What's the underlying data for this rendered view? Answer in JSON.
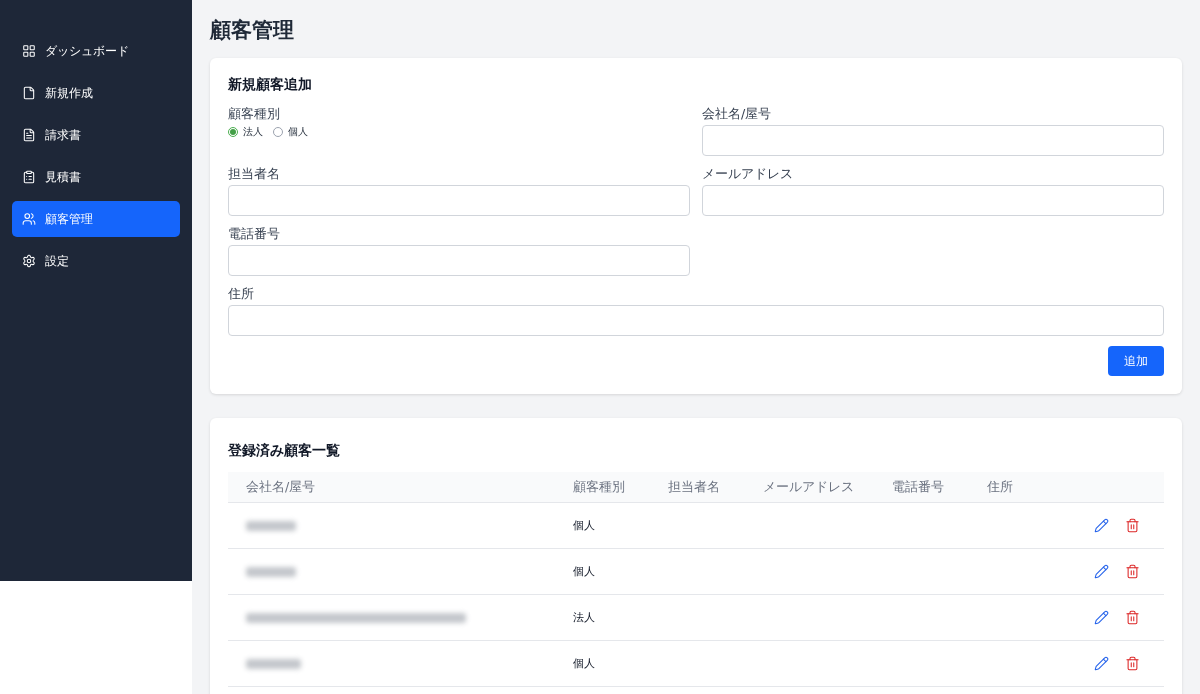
{
  "sidebar": {
    "items": [
      {
        "label": "ダッシュボード",
        "selected": false
      },
      {
        "label": "新規作成",
        "selected": false
      },
      {
        "label": "請求書",
        "selected": false
      },
      {
        "label": "見積書",
        "selected": false
      },
      {
        "label": "顧客管理",
        "selected": true
      },
      {
        "label": "設定",
        "selected": false
      }
    ]
  },
  "page_title": "顧客管理",
  "form": {
    "title": "新規顧客追加",
    "customer_type": {
      "label": "顧客種別",
      "options": [
        {
          "label": "法人",
          "selected": true
        },
        {
          "label": "個人",
          "selected": false
        }
      ]
    },
    "fields": [
      {
        "label": "会社名/屋号"
      },
      {
        "label": "担当者名"
      },
      {
        "label": "メールアドレス"
      },
      {
        "label": "電話番号"
      },
      {
        "label": "住所"
      }
    ],
    "submit": "追加"
  },
  "list": {
    "title": "登録済み顧客一覧",
    "columns": [
      "会社名/屋号",
      "顧客種別",
      "担当者名",
      "メールアドレス",
      "電話番号",
      "住所"
    ],
    "rows": [
      {
        "type": "個人"
      },
      {
        "type": "個人"
      },
      {
        "type": "法人"
      },
      {
        "type": "個人"
      }
    ]
  }
}
